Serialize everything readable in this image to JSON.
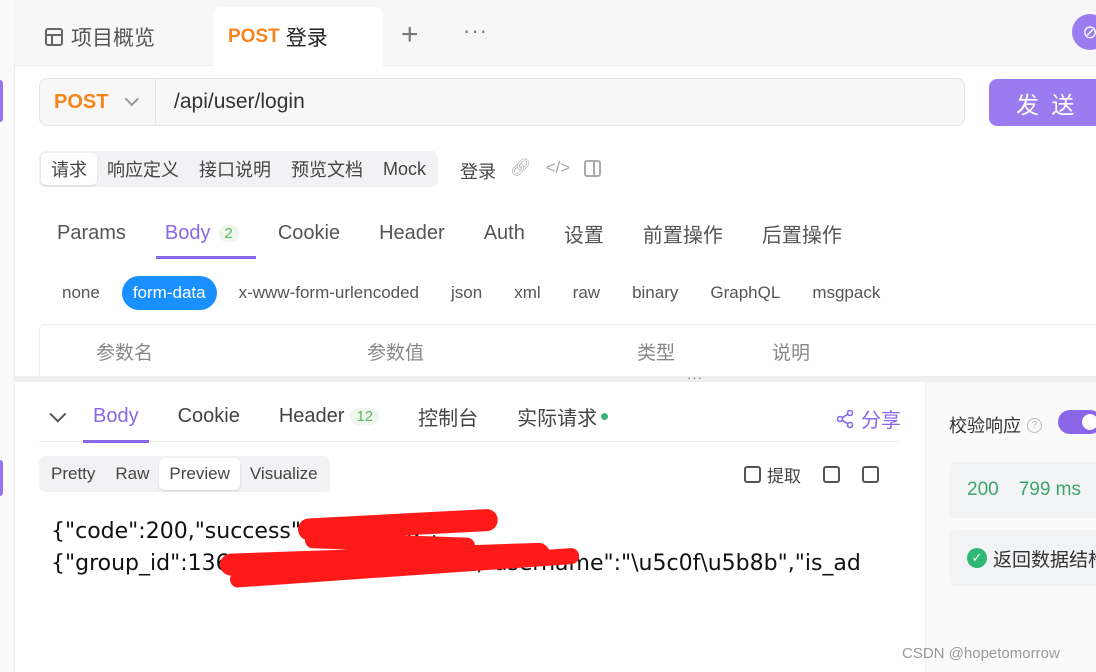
{
  "tabs": {
    "overview_label": "项目概览",
    "active_method": "POST",
    "active_title": "登录",
    "add": "+",
    "more": "···",
    "circle_icon": "⊘"
  },
  "request": {
    "method": "POST",
    "url": "/api/user/login",
    "send_label": "发 送"
  },
  "modes": {
    "items": [
      "请求",
      "响应定义",
      "接口说明",
      "预览文档",
      "Mock"
    ],
    "active": "请求",
    "endpoint_name": "登录"
  },
  "request_tabs": {
    "items": [
      "Params",
      "Body",
      "Cookie",
      "Header",
      "Auth",
      "设置",
      "前置操作",
      "后置操作"
    ],
    "active": "Body",
    "body_count": "2"
  },
  "body_types": {
    "items": [
      "none",
      "form-data",
      "x-www-form-urlencoded",
      "json",
      "xml",
      "raw",
      "binary",
      "GraphQL",
      "msgpack"
    ],
    "active": "form-data"
  },
  "params_table": {
    "columns": [
      "参数名",
      "参数值",
      "类型",
      "说明"
    ]
  },
  "splitter_dots": "···",
  "response": {
    "tabs": [
      "Body",
      "Cookie",
      "Header",
      "控制台",
      "实际请求"
    ],
    "active": "Body",
    "header_count": "12",
    "share_label": "分享",
    "view_modes": [
      "Pretty",
      "Raw",
      "Preview",
      "Visualize"
    ],
    "active_view": "Preview",
    "extract_label": "提取",
    "body_line1": "{\"code\":200,\"success\":true,\"data\":",
    "body_line2": "{\"group_id\":136,\"mobile\":\"\",\"name\":\"\",\"username\":\"\\u5c0f\\u5b8b\",\"is_ad"
  },
  "side_panel": {
    "verify_label": "校验响应",
    "status_code": "200",
    "duration": "799 ms",
    "check_label": "返回数据结构"
  },
  "watermark": "CSDN @hopetomorrow",
  "colors": {
    "accent": "#8a66e8",
    "method": "#f5841c",
    "pill": "#1890ff",
    "success": "#3ca56a"
  }
}
